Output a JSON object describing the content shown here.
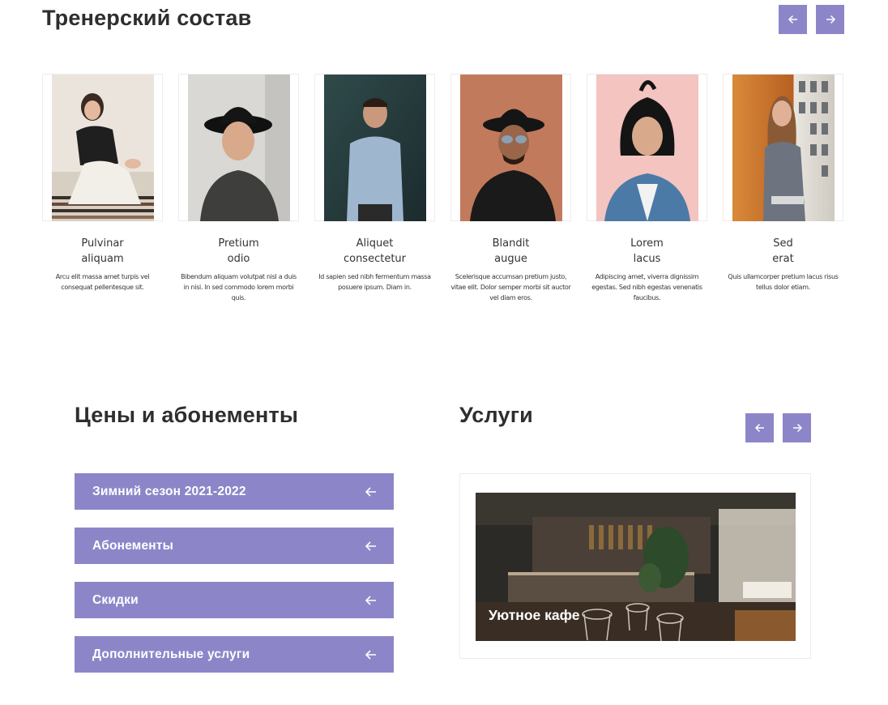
{
  "trainers_section": {
    "title": "Тренерский состав",
    "prev_icon": "arrow-left-icon",
    "next_icon": "arrow-right-icon",
    "trainers": [
      {
        "name_line1": "Pulvinar",
        "name_line2": "aliquam",
        "description": "Arcu elit massa amet turpis vel consequat pellentesque sit."
      },
      {
        "name_line1": "Pretium",
        "name_line2": "odio",
        "description": "Bibendum aliquam volutpat nisl a duis in nisi. In sed commodo lorem morbi quis."
      },
      {
        "name_line1": "Aliquet",
        "name_line2": "consectetur",
        "description": "Id sapien sed nibh fermentum massa posuere ipsum. Diam in."
      },
      {
        "name_line1": "Blandit",
        "name_line2": "augue",
        "description": "Scelerisque accumsan pretium justo, vitae elit. Dolor semper morbi sit auctor vel diam eros."
      },
      {
        "name_line1": "Lorem",
        "name_line2": "lacus",
        "description": "Adipiscing amet, viverra dignissim egestas. Sed nibh egestas venenatis faucibus."
      },
      {
        "name_line1": "Sed",
        "name_line2": "erat",
        "description": "Quis ullamcorper pretium lacus risus tellus dolor etiam."
      }
    ]
  },
  "pricing_section": {
    "title": "Цены и абонементы",
    "toggle_icon": "arrow-left-icon",
    "items": [
      {
        "label": "Зимний сезон 2021-2022"
      },
      {
        "label": "Абонементы"
      },
      {
        "label": "Скидки"
      },
      {
        "label": "Дополнительные услуги"
      }
    ]
  },
  "services_section": {
    "title": "Услуги",
    "card": {
      "title": "Уютное кафе"
    }
  },
  "colors": {
    "accent": "#8c86c9",
    "text": "#2e2e2e",
    "border": "#ececec"
  }
}
